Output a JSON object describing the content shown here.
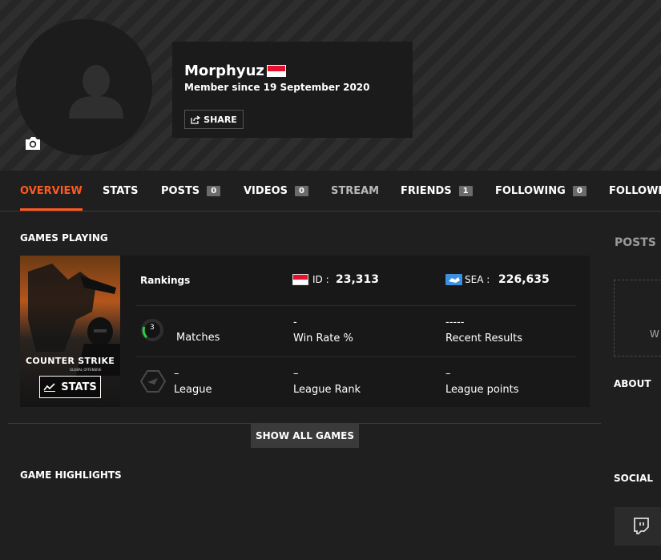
{
  "profile": {
    "username": "Morphyuz",
    "member_since": "Member since 19 September 2020",
    "share_label": "SHARE",
    "flag_colors": [
      "#e8112d",
      "#ffffff"
    ]
  },
  "nav": {
    "tabs": [
      {
        "label": "OVERVIEW",
        "active": true
      },
      {
        "label": "STATS"
      },
      {
        "label": "POSTS",
        "badge": "0"
      },
      {
        "label": "VIDEOS",
        "badge": "0"
      },
      {
        "label": "STREAM"
      },
      {
        "label": "FRIENDS",
        "badge": "1"
      },
      {
        "label": "FOLLOWING",
        "badge": "0"
      },
      {
        "label": "FOLLOWE"
      }
    ],
    "accent": "#ff5a1f"
  },
  "main": {
    "games_playing_title": "GAMES PLAYING",
    "game": {
      "logo_text": "COUNTER STRIKE",
      "logo_sub": "GLOBAL OFFENSIVE",
      "stats_button": "STATS",
      "rankings_label": "Rankings",
      "id_rank": {
        "label": "ID :",
        "value": "23,313"
      },
      "sea_rank": {
        "label": "SEA :",
        "value": "226,635"
      },
      "matches": {
        "count": "3",
        "label": "Matches"
      },
      "win_rate": {
        "value": "-",
        "label": "Win Rate %"
      },
      "recent_results": {
        "value": "-----",
        "label": "Recent Results"
      },
      "league": {
        "value": "–",
        "label": "League"
      },
      "league_rank": {
        "value": "–",
        "label": "League Rank"
      },
      "league_points": {
        "value": "–",
        "label": "League points"
      }
    },
    "show_all_games": "SHOW ALL GAMES",
    "game_highlights_title": "GAME HIGHLIGHTS"
  },
  "sidebar": {
    "posts_title": "POSTS",
    "posts_box_text": "W",
    "about_title": "ABOUT",
    "social_title": "SOCIAL"
  }
}
